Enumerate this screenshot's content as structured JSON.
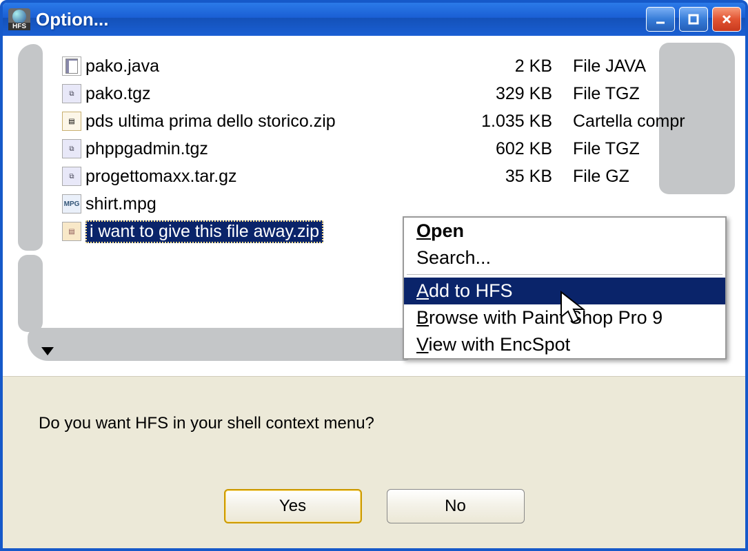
{
  "window": {
    "title": "Option...",
    "app_icon_label": "HFS"
  },
  "files": [
    {
      "icon": "java",
      "name": "pako.java",
      "size": "2 KB",
      "type": "File JAVA"
    },
    {
      "icon": "tgz",
      "name": "pako.tgz",
      "size": "329 KB",
      "type": "File TGZ"
    },
    {
      "icon": "zipf",
      "name": "pds ultima prima dello storico.zip",
      "size": "1.035 KB",
      "type": "Cartella compr"
    },
    {
      "icon": "tgz",
      "name": "phppgadmin.tgz",
      "size": "602 KB",
      "type": "File TGZ"
    },
    {
      "icon": "gz",
      "name": "progettomaxx.tar.gz",
      "size": "35 KB",
      "type": "File GZ"
    },
    {
      "icon": "mpg",
      "name": "shirt.mpg",
      "size": "",
      "type": ""
    },
    {
      "icon": "zip",
      "name": "i want to give this file away.zip",
      "size": "",
      "type": "",
      "selected": true
    }
  ],
  "context_menu": {
    "open": "Open",
    "search": "Search...",
    "add_hfs": "Add to HFS",
    "browse_psp": "Browse with Paint Shop Pro 9",
    "view_encspot": "View with EncSpot"
  },
  "dialog": {
    "message": "Do you want HFS in your shell context menu?",
    "yes": "Yes",
    "no": "No"
  }
}
